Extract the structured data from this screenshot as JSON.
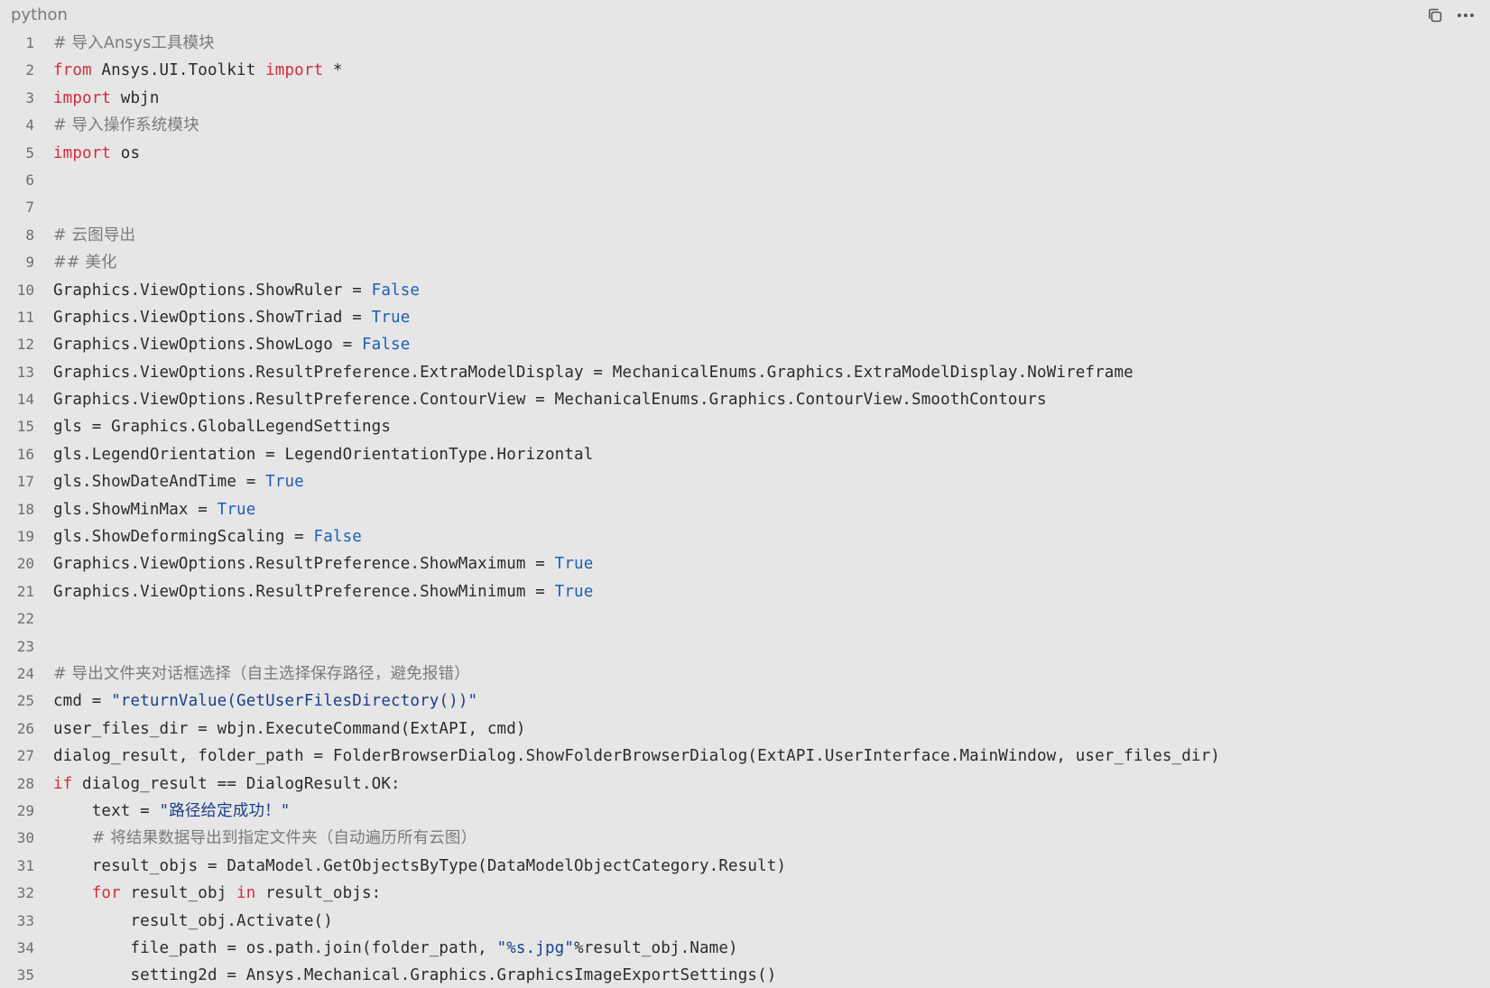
{
  "header": {
    "language": "python",
    "copy_icon": "copy-icon",
    "more_icon": "more-horizontal-icon"
  },
  "colors": {
    "background": "#e6e6e6",
    "keyword": "#d12d3f",
    "constant": "#1d5fb4",
    "string": "#1a3f8a",
    "comment": "#7a7a7a",
    "text": "#2b2b2b",
    "line_number": "#6e6e6e"
  },
  "lines": [
    {
      "n": "1",
      "tokens": [
        {
          "t": "com",
          "v": "# 导入Ansys工具模块"
        }
      ]
    },
    {
      "n": "2",
      "tokens": [
        {
          "t": "kw",
          "v": "from"
        },
        {
          "t": "txt",
          "v": " Ansys.UI.Toolkit "
        },
        {
          "t": "kw",
          "v": "import"
        },
        {
          "t": "txt",
          "v": " *"
        }
      ]
    },
    {
      "n": "3",
      "tokens": [
        {
          "t": "kw",
          "v": "import"
        },
        {
          "t": "txt",
          "v": " wbjn"
        }
      ]
    },
    {
      "n": "4",
      "tokens": [
        {
          "t": "com",
          "v": "# 导入操作系统模块"
        }
      ]
    },
    {
      "n": "5",
      "tokens": [
        {
          "t": "kw",
          "v": "import"
        },
        {
          "t": "txt",
          "v": " os"
        }
      ]
    },
    {
      "n": "6",
      "tokens": []
    },
    {
      "n": "7",
      "tokens": []
    },
    {
      "n": "8",
      "tokens": [
        {
          "t": "com",
          "v": "# 云图导出"
        }
      ]
    },
    {
      "n": "9",
      "tokens": [
        {
          "t": "com",
          "v": "## 美化"
        }
      ]
    },
    {
      "n": "10",
      "tokens": [
        {
          "t": "txt",
          "v": "Graphics.ViewOptions.ShowRuler = "
        },
        {
          "t": "const",
          "v": "False"
        }
      ]
    },
    {
      "n": "11",
      "tokens": [
        {
          "t": "txt",
          "v": "Graphics.ViewOptions.ShowTriad = "
        },
        {
          "t": "const",
          "v": "True"
        }
      ]
    },
    {
      "n": "12",
      "tokens": [
        {
          "t": "txt",
          "v": "Graphics.ViewOptions.ShowLogo = "
        },
        {
          "t": "const",
          "v": "False"
        }
      ]
    },
    {
      "n": "13",
      "tokens": [
        {
          "t": "txt",
          "v": "Graphics.ViewOptions.ResultPreference.ExtraModelDisplay = MechanicalEnums.Graphics.ExtraModelDisplay.NoWireframe"
        }
      ]
    },
    {
      "n": "14",
      "tokens": [
        {
          "t": "txt",
          "v": "Graphics.ViewOptions.ResultPreference.ContourView = MechanicalEnums.Graphics.ContourView.SmoothContours"
        }
      ]
    },
    {
      "n": "15",
      "tokens": [
        {
          "t": "txt",
          "v": "gls = Graphics.GlobalLegendSettings"
        }
      ]
    },
    {
      "n": "16",
      "tokens": [
        {
          "t": "txt",
          "v": "gls.LegendOrientation = LegendOrientationType.Horizontal"
        }
      ]
    },
    {
      "n": "17",
      "tokens": [
        {
          "t": "txt",
          "v": "gls.ShowDateAndTime = "
        },
        {
          "t": "const",
          "v": "True"
        }
      ]
    },
    {
      "n": "18",
      "tokens": [
        {
          "t": "txt",
          "v": "gls.ShowMinMax = "
        },
        {
          "t": "const",
          "v": "True"
        }
      ]
    },
    {
      "n": "19",
      "tokens": [
        {
          "t": "txt",
          "v": "gls.ShowDeformingScaling = "
        },
        {
          "t": "const",
          "v": "False"
        }
      ]
    },
    {
      "n": "20",
      "tokens": [
        {
          "t": "txt",
          "v": "Graphics.ViewOptions.ResultPreference.ShowMaximum = "
        },
        {
          "t": "const",
          "v": "True"
        }
      ]
    },
    {
      "n": "21",
      "tokens": [
        {
          "t": "txt",
          "v": "Graphics.ViewOptions.ResultPreference.ShowMinimum = "
        },
        {
          "t": "const",
          "v": "True"
        }
      ]
    },
    {
      "n": "22",
      "tokens": []
    },
    {
      "n": "23",
      "tokens": []
    },
    {
      "n": "24",
      "tokens": [
        {
          "t": "com",
          "v": "# 导出文件夹对话框选择（自主选择保存路径，避免报错）"
        }
      ]
    },
    {
      "n": "25",
      "tokens": [
        {
          "t": "txt",
          "v": "cmd = "
        },
        {
          "t": "str",
          "v": "\"returnValue(GetUserFilesDirectory())\""
        }
      ]
    },
    {
      "n": "26",
      "tokens": [
        {
          "t": "txt",
          "v": "user_files_dir = wbjn.ExecuteCommand(ExtAPI, cmd)"
        }
      ]
    },
    {
      "n": "27",
      "tokens": [
        {
          "t": "txt",
          "v": "dialog_result, folder_path = FolderBrowserDialog.ShowFolderBrowserDialog(ExtAPI.UserInterface.MainWindow, user_files_dir)"
        }
      ]
    },
    {
      "n": "28",
      "tokens": [
        {
          "t": "kw",
          "v": "if"
        },
        {
          "t": "txt",
          "v": " dialog_result == DialogResult.OK:"
        }
      ]
    },
    {
      "n": "29",
      "tokens": [
        {
          "t": "txt",
          "v": "    text = "
        },
        {
          "t": "str",
          "v": "\"路径给定成功！\""
        }
      ]
    },
    {
      "n": "30",
      "tokens": [
        {
          "t": "txt",
          "v": "    "
        },
        {
          "t": "com",
          "v": "# 将结果数据导出到指定文件夹（自动遍历所有云图）"
        }
      ]
    },
    {
      "n": "31",
      "tokens": [
        {
          "t": "txt",
          "v": "    result_objs = DataModel.GetObjectsByType(DataModelObjectCategory.Result)"
        }
      ]
    },
    {
      "n": "32",
      "tokens": [
        {
          "t": "txt",
          "v": "    "
        },
        {
          "t": "kw",
          "v": "for"
        },
        {
          "t": "txt",
          "v": " result_obj "
        },
        {
          "t": "kw",
          "v": "in"
        },
        {
          "t": "txt",
          "v": " result_objs:"
        }
      ]
    },
    {
      "n": "33",
      "tokens": [
        {
          "t": "txt",
          "v": "        result_obj.Activate()"
        }
      ]
    },
    {
      "n": "34",
      "tokens": [
        {
          "t": "txt",
          "v": "        file_path = os.path.join(folder_path, "
        },
        {
          "t": "str",
          "v": "\"%s.jpg\""
        },
        {
          "t": "txt",
          "v": "%result_obj.Name)"
        }
      ]
    },
    {
      "n": "35",
      "tokens": [
        {
          "t": "txt",
          "v": "        setting2d = Ansys.Mechanical.Graphics.GraphicsImageExportSettings()"
        }
      ]
    }
  ]
}
